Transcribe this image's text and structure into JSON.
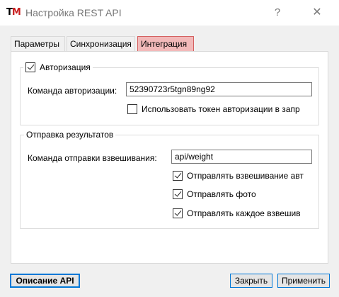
{
  "window": {
    "icon": {
      "letter1": "T",
      "letter2": "M"
    },
    "title": "Настройка REST API",
    "help": "?",
    "close": "✕"
  },
  "tabs": [
    {
      "label": "Параметры",
      "active": false
    },
    {
      "label": "Синхронизация",
      "active": false
    },
    {
      "label": "Интеграция",
      "active": true
    }
  ],
  "auth_group": {
    "legend": "Авторизация",
    "enabled": true,
    "command_label": "Команда авторизации:",
    "command_value": "52390723r5tgn89ng92",
    "use_token_label": "Использовать токен авторизации в запр",
    "use_token_checked": false
  },
  "send_group": {
    "legend": "Отправка результатов",
    "command_label": "Команда отправки взвешивания:",
    "command_value": "api/weight",
    "options": [
      {
        "label": "Отправлять взвешивание авт",
        "checked": true
      },
      {
        "label": "Отправлять фото",
        "checked": true
      },
      {
        "label": "Отправлять каждое взвешив",
        "checked": true
      }
    ]
  },
  "buttons": {
    "api_description": "Описание API",
    "close": "Закрыть",
    "apply": "Применить"
  },
  "colors": {
    "active_tab_bg": "#f2b9b9",
    "active_tab_border": "#d46060",
    "accent": "#0078d7",
    "logo_red": "#c81e1e"
  }
}
